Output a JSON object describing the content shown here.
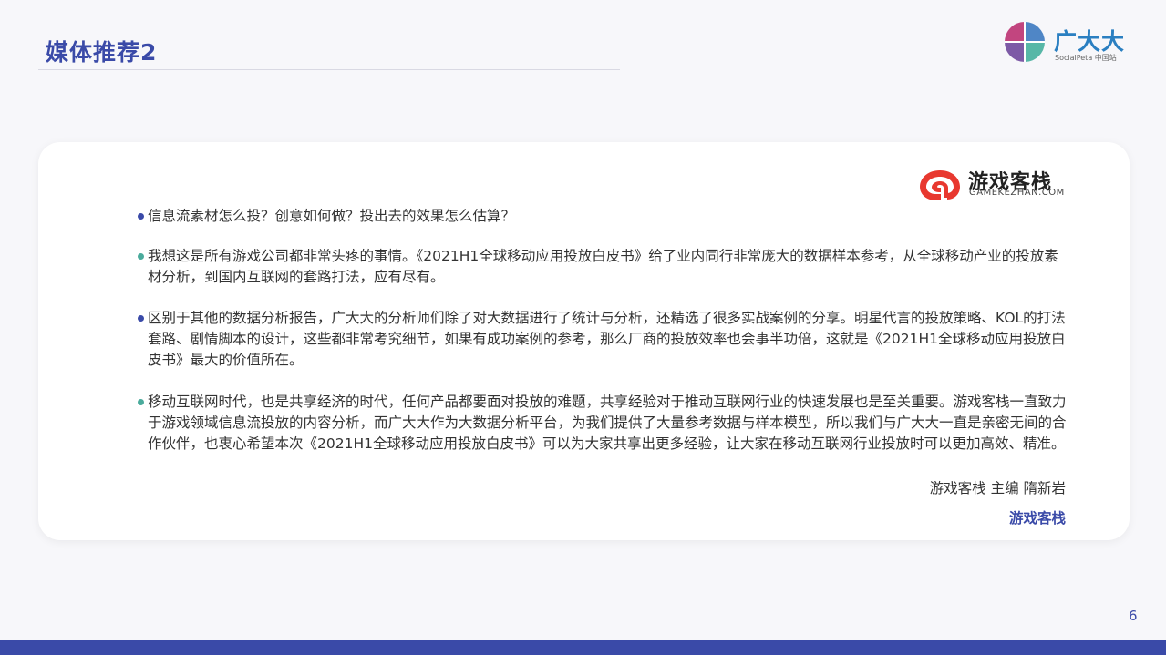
{
  "header": {
    "title": "媒体推荐2",
    "brand_name": "广大大",
    "brand_sub": "SocialPeta 中国站"
  },
  "card": {
    "logo_name": "游戏客栈",
    "logo_domain": "GAMEKEZHAN.COM",
    "paragraphs": [
      "信息流素材怎么投？创意如何做？投出去的效果怎么估算？",
      "我想这是所有游戏公司都非常头疼的事情。《2021H1全球移动应用投放白皮书》给了业内同行非常庞大的数据样本参考，从全球移动产业的投放素材分析，到国内互联网的套路打法，应有尽有。",
      "区别于其他的数据分析报告，广大大的分析师们除了对大数据进行了统计与分析，还精选了很多实战案例的分享。明星代言的投放策略、KOL的打法套路、剧情脚本的设计，这些都非常考究细节，如果有成功案例的参考，那么厂商的投放效率也会事半功倍，这就是《2021H1全球移动应用投放白皮书》最大的价值所在。",
      "移动互联网时代，也是共享经济的时代，任何产品都要面对投放的难题，共享经验对于推动互联网行业的快速发展也是至关重要。游戏客栈一直致力于游戏领域信息流投放的内容分析，而广大大作为大数据分析平台，为我们提供了大量参考数据与样本模型，所以我们与广大大一直是亲密无间的合作伙伴，也衷心希望本次《2021H1全球移动应用投放白皮书》可以为大家共享出更多经验，让大家在移动互联网行业投放时可以更加高效、精准。"
    ],
    "signature": "游戏客栈 主编 隋新岩",
    "footer_brand": "游戏客栈"
  },
  "page_number": "6",
  "colors": {
    "accent": "#3a4aa8",
    "teal": "#4aab9c",
    "logo_red": "#e8382f"
  }
}
